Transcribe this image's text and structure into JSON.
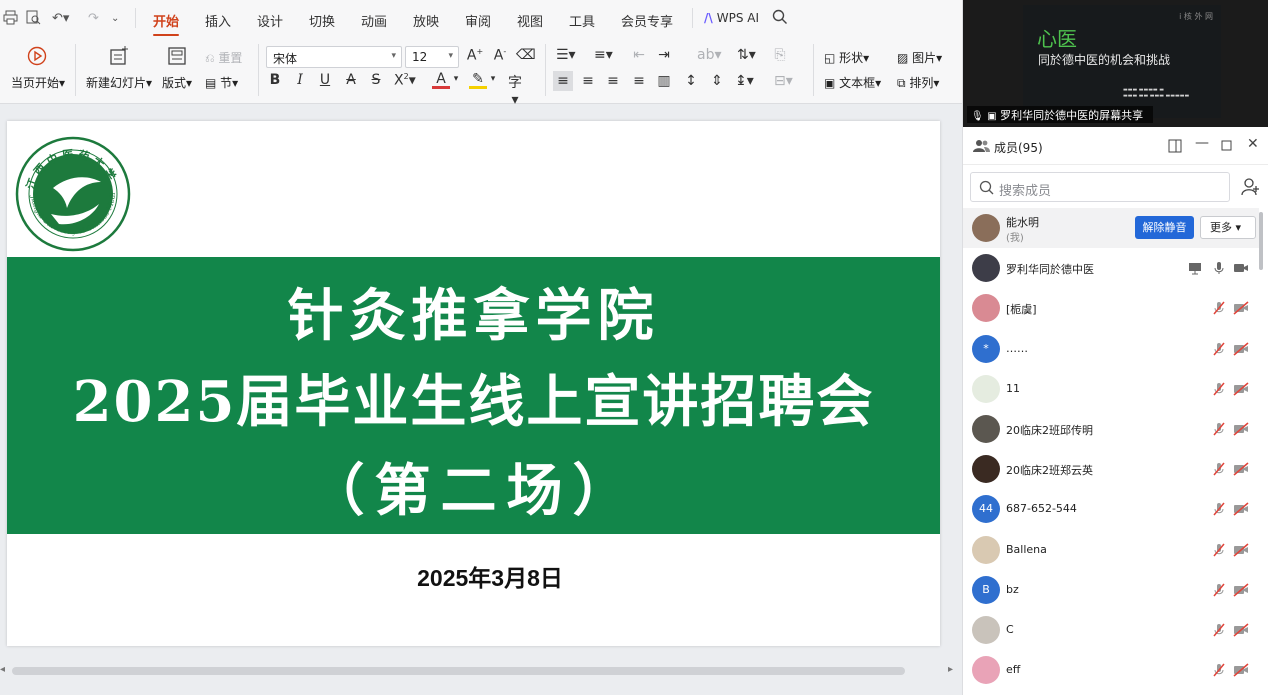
{
  "ribbon_tabs": [
    "开始",
    "插入",
    "设计",
    "切换",
    "动画",
    "放映",
    "审阅",
    "视图",
    "工具",
    "会员专享"
  ],
  "wps_ai": "WPS AI",
  "ribbon": {
    "from_current": "当页开始",
    "new_slide": "新建幻灯片",
    "layout": "版式",
    "reset": "重置",
    "section": "节",
    "font_name": "宋体",
    "font_size": "12",
    "shape": "形状",
    "picture": "图片",
    "textbox": "文本框",
    "arrange": "排列"
  },
  "slide": {
    "logo_text": "Jiangxi University of Chinese Medicine",
    "title_line1": "针灸推拿学院",
    "title_line2": "2025届毕业生线上宣讲招聘会",
    "title_line3": "（第二场）",
    "date": "2025年3月8日",
    "band_color": "#12864a"
  },
  "share": {
    "logo": "心医",
    "subtitle": "同於德中医的机会和挑战",
    "presenter_label": "罗利华同於德中医的屏幕共享"
  },
  "members": {
    "header": "成员(95)",
    "search_placeholder": "搜索成员",
    "me_tag": "(我)",
    "unmute_label": "解除静音",
    "more_label": "更多",
    "list": [
      {
        "name": "能水明",
        "avatar": "photo",
        "color": "#8a6e5a",
        "mic": "on",
        "cam": "none"
      },
      {
        "name": "罗利华同於德中医",
        "avatar": "photo",
        "color": "#3d3d48",
        "mic": "on",
        "cam": "on",
        "screen": true
      },
      {
        "name": "[栀虞]",
        "avatar": "photo",
        "color": "#d98a93",
        "mic": "muted",
        "cam": "off"
      },
      {
        "name": "……",
        "avatar": "*",
        "color": "#2f6fcf",
        "mic": "muted",
        "cam": "off"
      },
      {
        "name": "11",
        "avatar": "photo",
        "color": "#e5ece0",
        "mic": "muted",
        "cam": "off"
      },
      {
        "name": "20临床2班邱传明",
        "avatar": "photo",
        "color": "#5b5750",
        "mic": "muted",
        "cam": "off"
      },
      {
        "name": "20临床2班郑云英",
        "avatar": "photo",
        "color": "#3a2a22",
        "mic": "muted",
        "cam": "off"
      },
      {
        "name": "687-652-544",
        "avatar": "44",
        "color": "#2f6fcf",
        "mic": "muted",
        "cam": "off"
      },
      {
        "name": "Ballena",
        "avatar": "photo",
        "color": "#d9c9b2",
        "mic": "muted",
        "cam": "off"
      },
      {
        "name": "bz",
        "avatar": "B",
        "color": "#2f6fcf",
        "mic": "muted",
        "cam": "off"
      },
      {
        "name": "C",
        "avatar": "photo",
        "color": "#c9c3bb",
        "mic": "muted",
        "cam": "off"
      },
      {
        "name": "eff",
        "avatar": "photo",
        "color": "#e9a3b7",
        "mic": "muted",
        "cam": "off"
      }
    ]
  }
}
